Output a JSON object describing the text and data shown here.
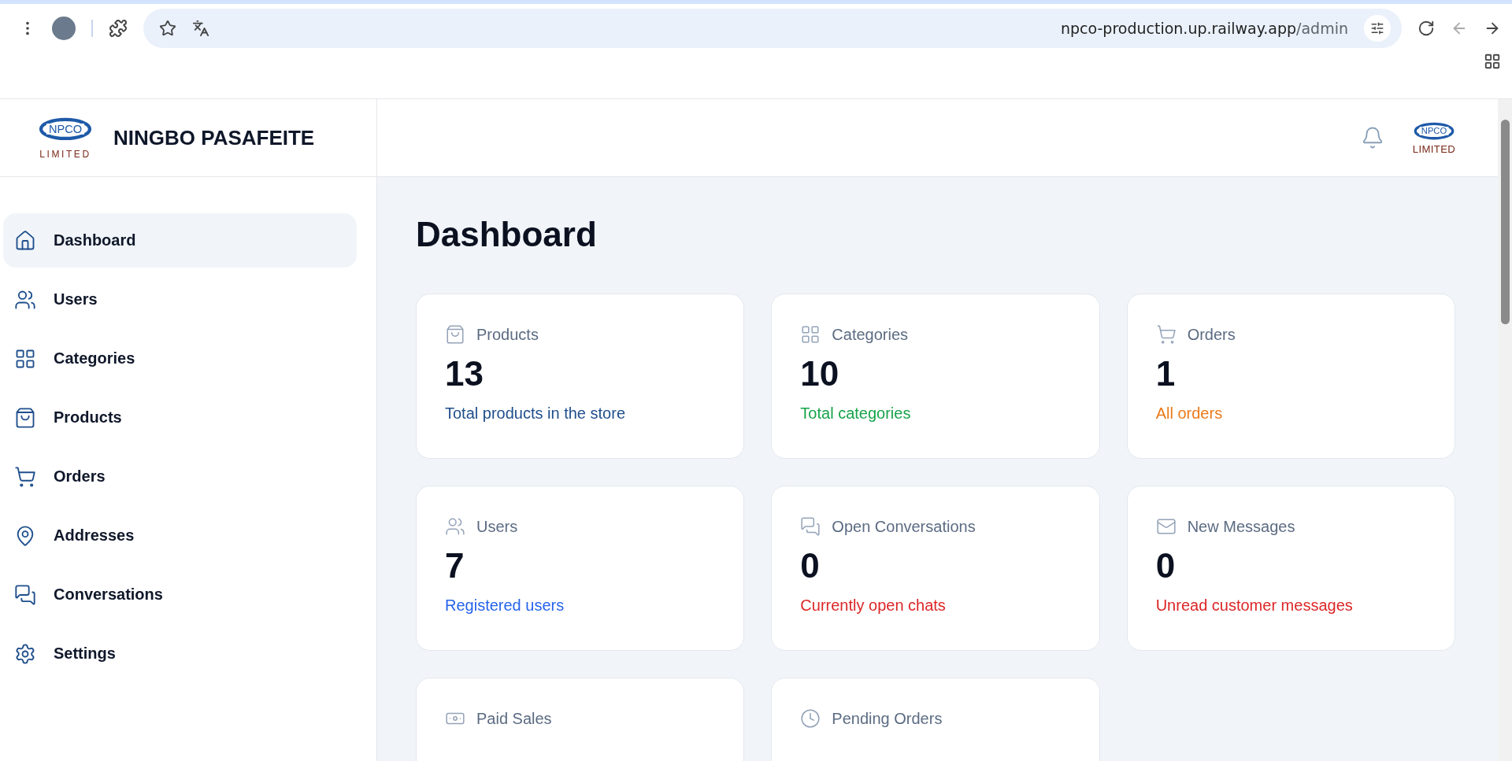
{
  "browser": {
    "url_host": "npco-production.up.railway.app",
    "url_path": "/admin"
  },
  "brand": {
    "logo_mark": "NPCO",
    "logo_sub": "LIMITED",
    "name": "NINGBO PASAFEITE"
  },
  "header": {
    "avatar_mark": "NPCO",
    "avatar_sub": "LIMITED"
  },
  "sidebar": {
    "items": [
      {
        "label": "Dashboard",
        "selected": true
      },
      {
        "label": "Users",
        "selected": false
      },
      {
        "label": "Categories",
        "selected": false
      },
      {
        "label": "Products",
        "selected": false
      },
      {
        "label": "Orders",
        "selected": false
      },
      {
        "label": "Addresses",
        "selected": false
      },
      {
        "label": "Conversations",
        "selected": false
      },
      {
        "label": "Settings",
        "selected": false
      }
    ]
  },
  "page": {
    "title": "Dashboard"
  },
  "cards": [
    {
      "title": "Products",
      "value": "13",
      "note": "Total products in the store",
      "color": "#1e4e8c"
    },
    {
      "title": "Categories",
      "value": "10",
      "note": "Total categories",
      "color": "#16a34a"
    },
    {
      "title": "Orders",
      "value": "1",
      "note": "All orders",
      "color": "#ea7a1a"
    },
    {
      "title": "Users",
      "value": "7",
      "note": "Registered users",
      "color": "#2563eb"
    },
    {
      "title": "Open Conversations",
      "value": "0",
      "note": "Currently open chats",
      "color": "#dc2626"
    },
    {
      "title": "New Messages",
      "value": "0",
      "note": "Unread customer messages",
      "color": "#dc2626"
    },
    {
      "title": "Paid Sales"
    },
    {
      "title": "Pending Orders"
    }
  ]
}
